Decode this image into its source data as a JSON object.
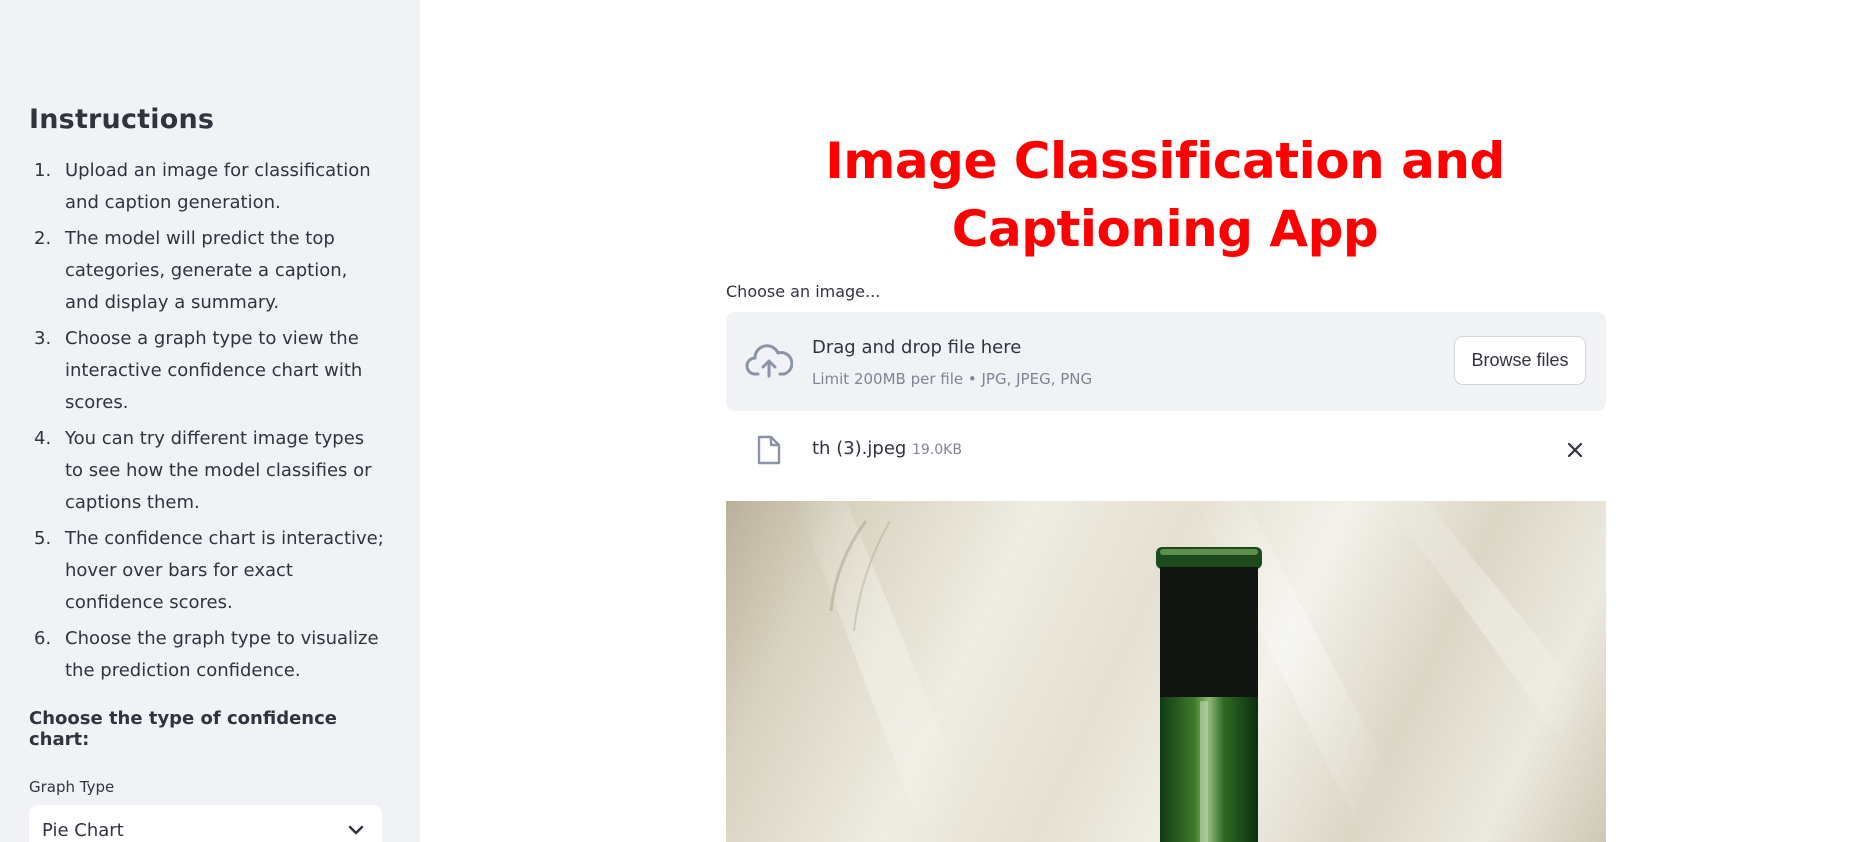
{
  "sidebar": {
    "title": "Instructions",
    "instructions": [
      {
        "num": "1.",
        "text": "Upload an image for classification and caption generation."
      },
      {
        "num": "2.",
        "text": "The model will predict the top categories, generate a caption, and display a summary."
      },
      {
        "num": "3.",
        "text": "Choose a graph type to view the interactive confidence chart with scores."
      },
      {
        "num": "4.",
        "text": "You can try different image types to see how the model classifies or captions them."
      },
      {
        "num": "5.",
        "text": "The confidence chart is interactive; hover over bars for exact confidence scores."
      },
      {
        "num": "6.",
        "text": "Choose the graph type to visualize the prediction confidence."
      }
    ],
    "chart_heading": "Choose the type of confidence chart:",
    "graph_type_label": "Graph Type",
    "graph_type_value": "Pie Chart"
  },
  "main": {
    "title": "Image Classification and Captioning App",
    "uploader": {
      "label": "Choose an image...",
      "drag_text": "Drag and drop file here",
      "limit_text": "Limit 200MB per file • JPG, JPEG, PNG",
      "browse_label": "Browse files"
    },
    "file": {
      "name": "th (3).jpeg",
      "size": "19.0KB"
    }
  },
  "icons": {
    "upload": "cloud-upload-icon",
    "file": "file-icon",
    "remove": "close-icon",
    "dropdown": "chevron-down-icon"
  },
  "colors": {
    "title": "#ff0000",
    "sidebar_bg": "#f0f2f6",
    "muted_text": "#808495"
  }
}
